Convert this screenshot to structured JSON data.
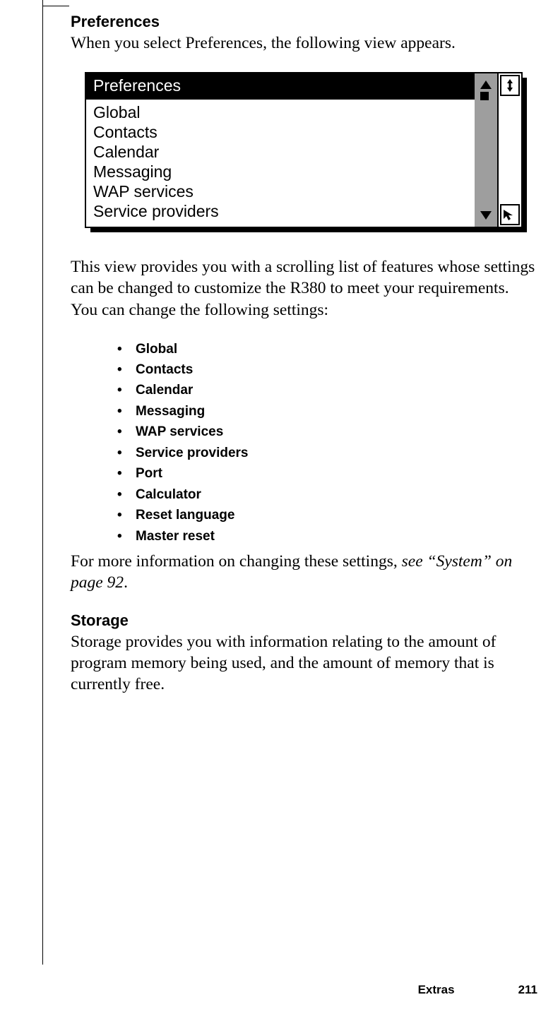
{
  "section1": {
    "heading": "Preferences",
    "intro": "When you select Preferences, the following view appears."
  },
  "device": {
    "title": "Preferences",
    "items": [
      "Global",
      "Contacts",
      "Calendar",
      "Messaging",
      "WAP services",
      "Service providers"
    ]
  },
  "para2": "This view provides you with a scrolling list of features whose settings can be changed to customize the R380 to meet your requirements. You can change the following settings:",
  "settings_list": [
    "Global",
    "Contacts",
    "Calendar",
    "Messaging",
    "WAP services",
    "Service providers",
    "Port",
    "Calculator",
    "Reset language",
    "Master reset"
  ],
  "para3_pre": "For more information on changing these settings, ",
  "para3_ital": "see “System” on page 92",
  "para3_post": ".",
  "section2": {
    "heading": "Storage",
    "body": "Storage provides you with information relating to the amount of program memory being used, and the amount of memory that is currently free."
  },
  "footer": {
    "section": "Extras",
    "page": "211"
  }
}
